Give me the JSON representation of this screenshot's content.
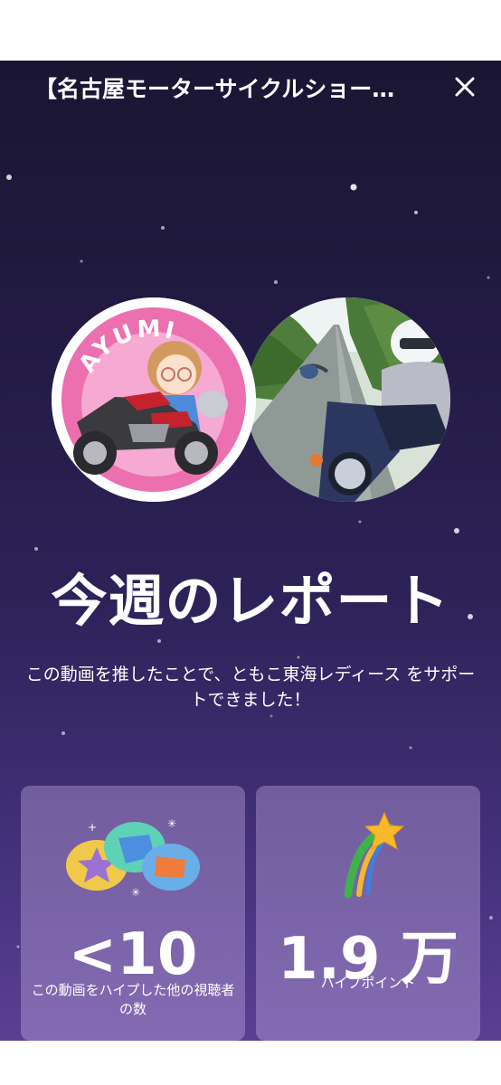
{
  "header": {
    "title": "【名古屋モーターサイクルショー…",
    "close_icon": "close-icon"
  },
  "avatars": {
    "left_badge_text": "AYUMI"
  },
  "report": {
    "headline": "今週のレポート",
    "description": "この動画を推したことで、ともこ東海レディース をサポートできました！"
  },
  "stats": {
    "viewers": {
      "value": "<10",
      "label": "この動画をハイプした他の視聴者の数"
    },
    "points": {
      "value": "1.9 万",
      "label": "ハイプポイント"
    }
  },
  "colors": {
    "panel_top": "#1a1532",
    "panel_bottom": "#5a3f94",
    "avatar_pink": "#ec6fb0"
  }
}
